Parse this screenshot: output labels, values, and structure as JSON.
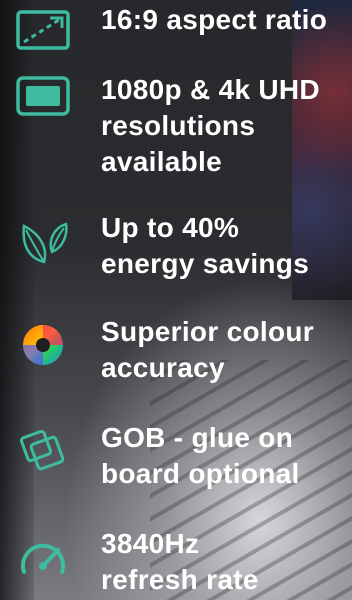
{
  "accent": "#3dbca0",
  "features": [
    {
      "icon": "aspect-ratio-icon",
      "text": "16:9 aspect ratio"
    },
    {
      "icon": "screen-icon",
      "text": "1080p & 4k UHD\nresolutions\navailable"
    },
    {
      "icon": "leaf-icon",
      "text": "Up to 40%\nenergy savings"
    },
    {
      "icon": "colour-wheel-icon",
      "text": "Superior colour\naccuracy"
    },
    {
      "icon": "layers-icon",
      "text": "GOB - glue on\nboard optional"
    },
    {
      "icon": "gauge-icon",
      "text": "3840Hz\nrefresh rate"
    }
  ]
}
